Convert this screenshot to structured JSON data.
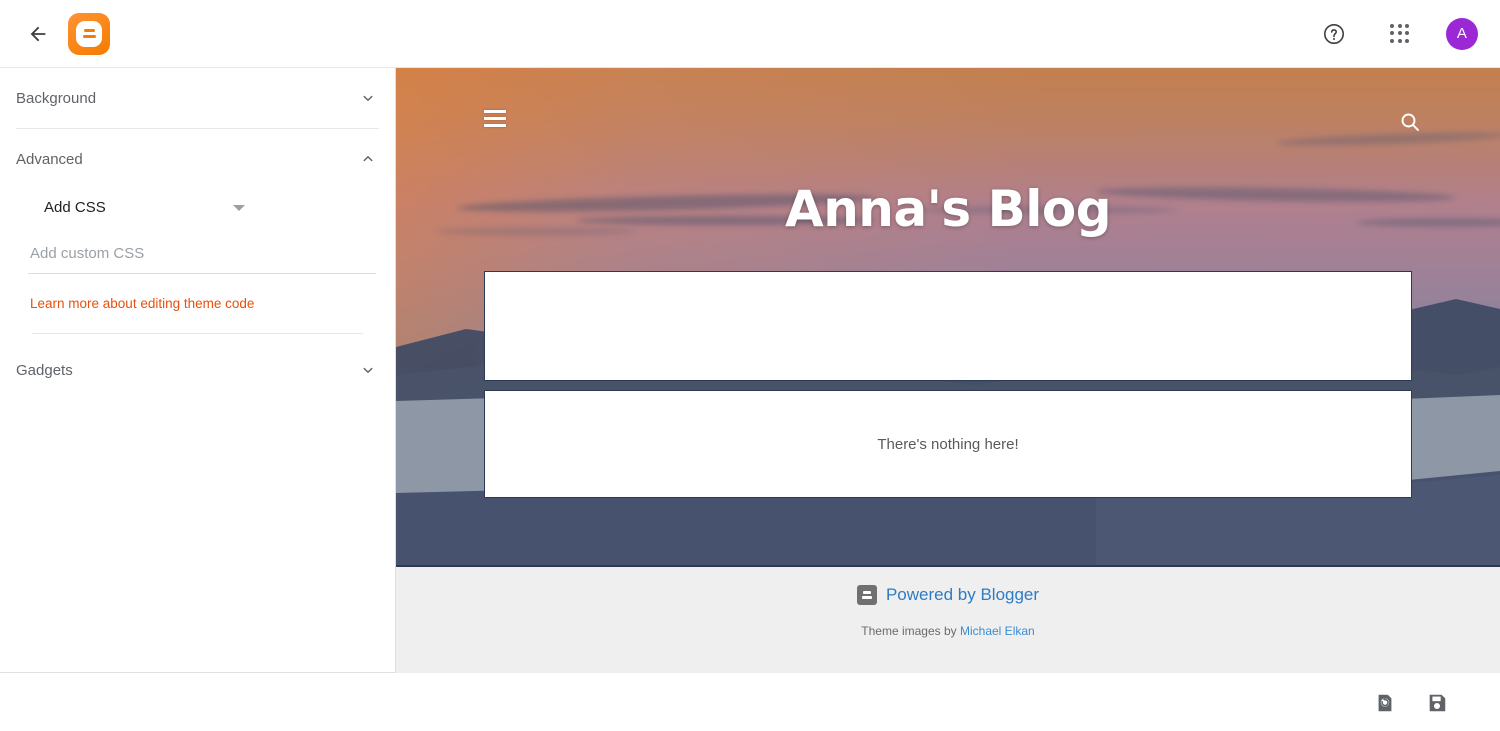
{
  "topbar": {
    "back_icon": "arrow-back-icon",
    "logo_icon": "blogger-logo-icon",
    "help_icon": "help-circle-icon",
    "apps_icon": "apps-grid-icon",
    "avatar_initial": "A",
    "avatar_color": "#9c27d4"
  },
  "sidebar": {
    "sections": [
      {
        "label": "Background",
        "expanded": false,
        "chevron": "chevron-down-icon"
      },
      {
        "label": "Advanced",
        "expanded": true,
        "chevron": "chevron-up-icon"
      },
      {
        "label": "Gadgets",
        "expanded": false,
        "chevron": "chevron-down-icon"
      }
    ],
    "advanced": {
      "select_label": "Add CSS",
      "select_caret": "caret-down-icon",
      "css_input_value": "",
      "css_input_placeholder": "Add custom CSS",
      "learn_link": "Learn more about editing theme code",
      "learn_link_color": "#e8500e"
    }
  },
  "preview": {
    "menu_icon": "hamburger-menu-icon",
    "search_icon": "search-icon",
    "blog_title": "Anna's Blog",
    "empty_message": "There's nothing here!",
    "footer": {
      "powered_icon": "blogger-badge-icon",
      "powered_text": "Powered by Blogger",
      "powered_color": "#2d7cc4",
      "credit_prefix": "Theme images by ",
      "credit_author": "Michael Elkan",
      "credit_link_color": "#3c8dd0"
    }
  },
  "bottombar": {
    "revert_icon": "revert-icon",
    "save_icon": "save-icon"
  }
}
